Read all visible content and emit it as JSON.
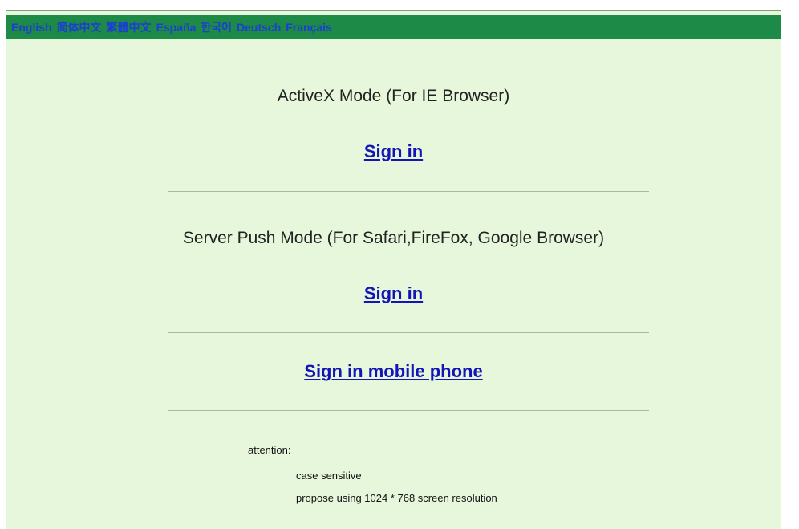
{
  "languages": [
    "English",
    "简体中文",
    "繁體中文",
    "España",
    "한국어",
    "Deutsch",
    "Français"
  ],
  "activex": {
    "title": "ActiveX Mode (For IE Browser)",
    "signin_label": "Sign in"
  },
  "serverpush": {
    "title": "Server Push Mode (For Safari,FireFox, Google Browser)",
    "signin_label": "Sign in"
  },
  "mobile": {
    "signin_label": "Sign in mobile phone"
  },
  "notes": {
    "heading": "attention:",
    "items": [
      "case sensitive",
      "propose using 1024 * 768 screen resolution"
    ]
  },
  "colors": {
    "background": "#e6f7db",
    "lang_bar": "#1e8a47",
    "link": "#1414b8",
    "lang_link": "#1b3fd1"
  }
}
